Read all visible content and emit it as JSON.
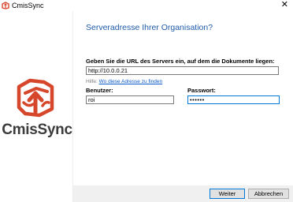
{
  "window": {
    "title": "CmisSync",
    "close_glyph": "✕"
  },
  "sidebar": {
    "logo_text": "CmisSync",
    "logo_icon": "cmissync-logo-icon",
    "brand_color": "#d6462b"
  },
  "page": {
    "headline": "Serveradresse Ihrer Organisation?",
    "url_label": "Geben Sie die URL des Servers ein, auf dem die Dokumente liegen:",
    "url_value": "http://10.0.0.21",
    "help_prefix": "Hilfe:",
    "help_link": "Wo diese Adresse zu finden",
    "user_label": "Benutzer:",
    "user_value": "roi",
    "password_label": "Passwort:",
    "password_value": "••••••"
  },
  "footer": {
    "next_label": "Weiter",
    "cancel_label": "Abbrechen"
  }
}
